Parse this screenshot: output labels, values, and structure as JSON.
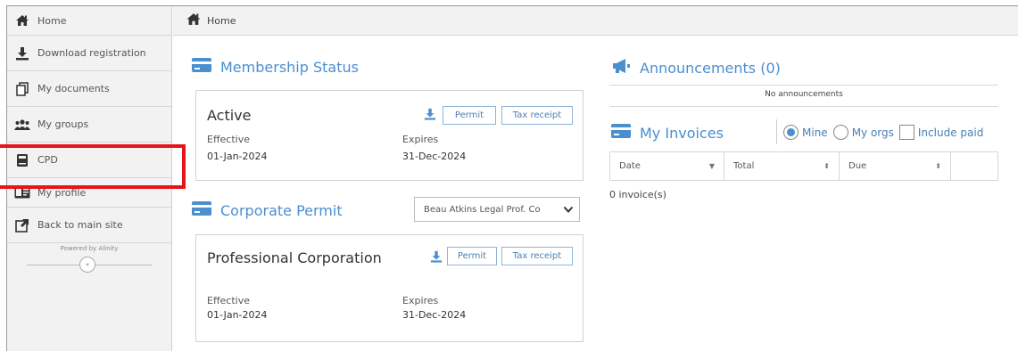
{
  "sidebar": {
    "items": [
      {
        "label": "Home",
        "icon": "home-icon"
      },
      {
        "label": "Download registration",
        "icon": "download-icon"
      },
      {
        "label": "My documents",
        "icon": "documents-icon"
      },
      {
        "label": "My groups",
        "icon": "groups-icon"
      },
      {
        "label": "CPD",
        "icon": "book-icon"
      },
      {
        "label": "My profile",
        "icon": "id-card-icon"
      },
      {
        "label": "Back to main site",
        "icon": "external-link-icon"
      }
    ],
    "powered_by": "Powered by Alinity",
    "collapse_label": "«"
  },
  "breadcrumb": {
    "label": "Home"
  },
  "membership": {
    "title": "Membership Status",
    "status": "Active",
    "effective_label": "Effective",
    "effective_date": "01-Jan-2024",
    "expires_label": "Expires",
    "expires_date": "31-Dec-2024",
    "permit_button": "Permit",
    "tax_receipt_button": "Tax receipt"
  },
  "corporate": {
    "title": "Corporate Permit",
    "select_value": "Beau Atkins Legal Prof. Co",
    "status": "Professional Corporation",
    "effective_label": "Effective",
    "effective_date": "01-Jan-2024",
    "expires_label": "Expires",
    "expires_date": "31-Dec-2024",
    "permit_button": "Permit",
    "tax_receipt_button": "Tax receipt"
  },
  "announcements": {
    "title": "Announcements (0)",
    "empty_text": "No announcements"
  },
  "invoices": {
    "title": "My Invoices",
    "filters": {
      "mine": "Mine",
      "my_orgs": "My orgs",
      "include_paid": "Include paid"
    },
    "columns": [
      {
        "label": "Date",
        "sort": "▼"
      },
      {
        "label": "Total",
        "sort": "⬍"
      },
      {
        "label": "Due",
        "sort": "⬍"
      },
      {
        "label": "",
        "sort": ""
      }
    ],
    "count_text": "0 invoice(s)"
  },
  "colors": {
    "accent": "#4a8fcf",
    "highlight": "#e8141c"
  }
}
